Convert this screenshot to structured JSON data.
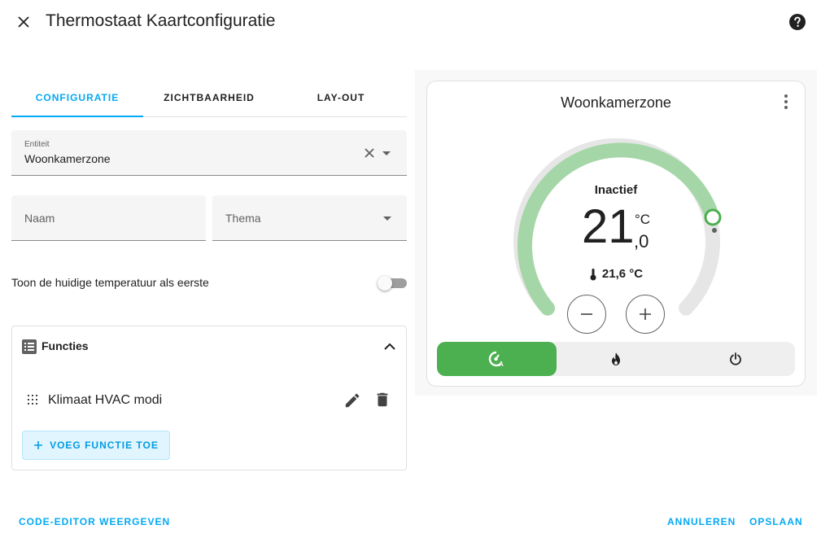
{
  "dialog": {
    "title": "Thermostaat Kaartconfiguratie"
  },
  "tabs": [
    {
      "label": "CONFIGURATIE",
      "active": true
    },
    {
      "label": "ZICHTBAARHEID",
      "active": false
    },
    {
      "label": "LAY-OUT",
      "active": false
    }
  ],
  "form": {
    "entity_label": "Entiteit",
    "entity_value": "Woonkamerzone",
    "name_placeholder": "Naam",
    "theme_placeholder": "Thema",
    "toggle_label": "Toon de huidige temperatuur als eerste",
    "toggle_on": false
  },
  "features": {
    "title": "Functies",
    "items": [
      {
        "name": "Klimaat HVAC modi"
      }
    ],
    "add_label": "VOEG FUNCTIE TOE"
  },
  "footer": {
    "code_editor_label": "CODE-EDITOR WEERGEVEN",
    "cancel_label": "ANNULEREN",
    "save_label": "OPSLAAN"
  },
  "preview": {
    "card_title": "Woonkamerzone",
    "hvac_action": "Inactief",
    "target_integer": "21",
    "target_decimal": ",0",
    "target_unit": "°C",
    "current_temperature": "21,6 °C",
    "modes": [
      {
        "icon": "thermostat-auto-icon",
        "active": true
      },
      {
        "icon": "fire-icon",
        "active": false
      },
      {
        "icon": "power-icon",
        "active": false
      }
    ],
    "colors": {
      "accent": "#03a9f4",
      "heat_mode": "#4caf50",
      "arc_active": "#a5d6a7",
      "arc_inactive": "#e6e6e6"
    }
  }
}
